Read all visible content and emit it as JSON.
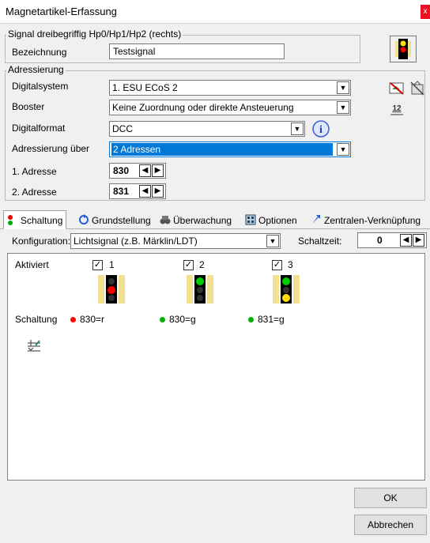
{
  "window": {
    "title": "Magnetartikel-Erfassung",
    "close_glyph": "x"
  },
  "signal_group": {
    "title": "Signal dreibegriffig Hp0/Hp1/Hp2 (rechts)",
    "name_label": "Bezeichnung",
    "name_value": "Testsignal"
  },
  "addressing": {
    "title": "Adressierung",
    "digitalsystem_label": "Digitalsystem",
    "digitalsystem_value": "1. ESU ECoS 2",
    "booster_label": "Booster",
    "booster_value": "Keine Zuordnung oder direkte Ansteuerung",
    "format_label": "Digitalformat",
    "format_value": "DCC",
    "adressierung_label": "Adressierung über",
    "adressierung_value": "2 Adressen",
    "address1_label": "1. Adresse",
    "address1_value": "830",
    "address2_label": "2. Adresse",
    "address2_value": "831",
    "info_glyph": "i",
    "number_icon_text": "12"
  },
  "tabs": [
    {
      "label": "Schaltung",
      "icon": "switching-icon"
    },
    {
      "label": "Grundstellung",
      "icon": "reset-icon"
    },
    {
      "label": "Überwachung",
      "icon": "binoculars-icon"
    },
    {
      "label": "Optionen",
      "icon": "options-icon"
    },
    {
      "label": "Zentralen-Verknüpfung",
      "icon": "link-icon"
    }
  ],
  "config": {
    "label": "Konfiguration:",
    "value": "Lichtsignal (z.B. Märklin/LDT)",
    "switchtime_label": "Schaltzeit:",
    "switchtime_value": "0"
  },
  "states": {
    "activated_label": "Aktiviert",
    "switching_label": "Schaltung",
    "items": [
      {
        "num": "1",
        "checked": "✓",
        "aspect": "red",
        "dot_color": "#ff0000",
        "command": "830=r"
      },
      {
        "num": "2",
        "checked": "✓",
        "aspect": "green",
        "dot_color": "#00b000",
        "command": "830=g"
      },
      {
        "num": "3",
        "checked": "✓",
        "aspect": "green-yellow",
        "dot_color": "#00b000",
        "command": "831=g"
      }
    ]
  },
  "buttons": {
    "ok": "OK",
    "cancel": "Abbrechen"
  },
  "colors": {
    "accent": "#0078d7",
    "signal_red": "#ff0000",
    "signal_green": "#00cc00",
    "signal_yellow": "#ffe000",
    "signal_bg": "#f0e090"
  }
}
